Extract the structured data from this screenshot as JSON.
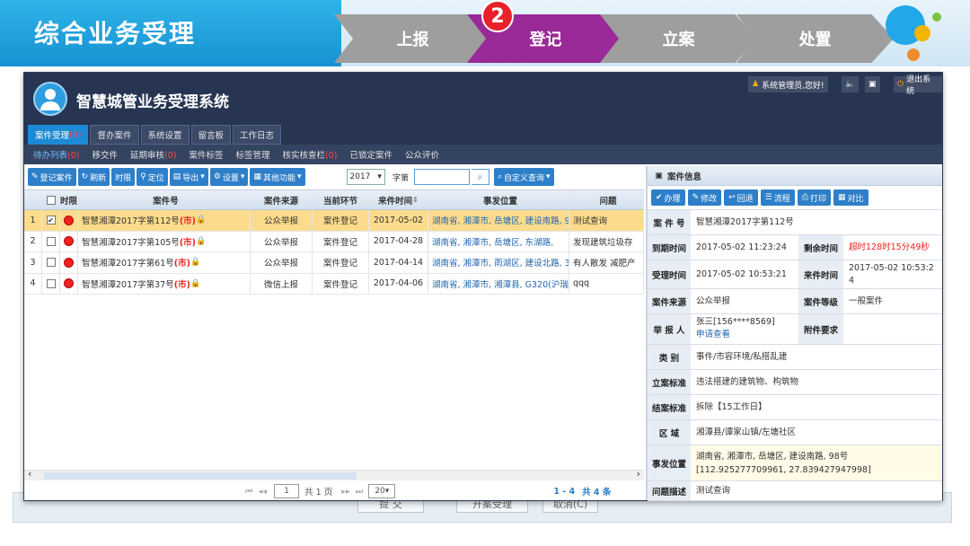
{
  "banner": {
    "title": "综合业务受理",
    "steps": [
      "上报",
      "登记",
      "立案",
      "处置"
    ],
    "active_step_number": "2"
  },
  "app": {
    "title": "智慧城管业务受理系统",
    "header_right": {
      "user": "系统管理员,您好!",
      "logout": "退出系统"
    },
    "menu_tabs": [
      {
        "label": "案件受理",
        "count": "(0)"
      },
      {
        "label": "督办案件"
      },
      {
        "label": "系统设置"
      },
      {
        "label": "留言板"
      },
      {
        "label": "工作日志"
      }
    ],
    "sub_menu": [
      {
        "label": "待办列表",
        "count": "(0)"
      },
      {
        "label": "移交件"
      },
      {
        "label": "延期审核",
        "count": "(0)"
      },
      {
        "label": "案件标签"
      },
      {
        "label": "标签管理"
      },
      {
        "label": "核实核查栏",
        "count": "(0)"
      },
      {
        "label": "已锁定案件"
      },
      {
        "label": "公众评价"
      }
    ],
    "toolbar": {
      "register": "登记案件",
      "refresh": "刷新",
      "time_limit": "时限",
      "locate": "定位",
      "export": "导出",
      "settings": "设置",
      "other": "其他功能",
      "year": "2017",
      "word_label": "字第",
      "custom_query": "自定义查询"
    },
    "table": {
      "headers": [
        "时限",
        "案件号",
        "案件来源",
        "当前环节",
        "来件时间",
        "事发位置",
        "问题"
      ],
      "rows": [
        {
          "no": "1",
          "case": "智慧湘潭2017字第112号",
          "tag": "(市)",
          "source": "公众举报",
          "stage": "案件登记",
          "time": "2017-05-02",
          "location": "湖南省, 湘潭市, 岳塘区, 建设南路, 9",
          "issue": "测试查询",
          "checked": true
        },
        {
          "no": "2",
          "case": "智慧湘潭2017字第105号",
          "tag": "(市)",
          "source": "公众举报",
          "stage": "案件登记",
          "time": "2017-04-28",
          "location": "湖南省, 湘潭市, 岳塘区, 东湖路,",
          "issue": "发现建筑垃圾存",
          "checked": false
        },
        {
          "no": "3",
          "case": "智慧湘潭2017字第61号",
          "tag": "(市)",
          "source": "公众举报",
          "stage": "案件登记",
          "time": "2017-04-14",
          "location": "湖南省, 湘潭市, 雨湖区, 建设北路, 3",
          "issue": "有人散发 减肥产",
          "checked": false
        },
        {
          "no": "4",
          "case": "智慧湘潭2017字第37号",
          "tag": "(市)",
          "source": "微信上报",
          "stage": "案件登记",
          "time": "2017-04-06",
          "location": "湖南省, 湘潭市, 湘潭县, G320(沪瑞)",
          "issue": "qqq",
          "checked": false
        }
      ]
    },
    "pager": {
      "page": "1",
      "total_pages": "共 1 页",
      "page_size": "20",
      "range": "1 - 4",
      "total": "共 4 条"
    },
    "panel": {
      "title": "案件信息",
      "buttons": [
        "办理",
        "修改",
        "回退",
        "流程",
        "打印",
        "对比"
      ],
      "fields": {
        "case_no_label": "案 件 号",
        "case_no": "智慧湘潭2017字第112号",
        "arrive_label": "到期时间",
        "arrive": "2017-05-02 11:23:24",
        "remain_label": "剩余时间",
        "remain": "超时128时15分49秒",
        "accept_label": "受理时间",
        "accept": "2017-05-02 10:53:21",
        "incoming_label": "来件时间",
        "incoming": "2017-05-02 10:53:24",
        "source_label": "案件来源",
        "source": "公众举报",
        "level_label": "案件等级",
        "level": "一般案件",
        "reporter_label": "举 报 人",
        "reporter": "张三[156****8569]",
        "reporter_link": "申请查看",
        "attach_label": "附件要求",
        "attach": "",
        "category_label": "类 别",
        "category": "事件/市容环境/私搭乱建",
        "standard_label": "立案标准",
        "standard": "违法搭建的建筑物、构筑物",
        "close_label": "结案标准",
        "close": "拆除【15工作日】",
        "area_label": "区 域",
        "area": "湘潭县/谭家山镇/左塘社区",
        "place_label": "事发位置",
        "place": "湖南省, 湘潭市, 岳塘区, 建设南路, 98号[112.925277709961, 27.839427947998]",
        "desc_label": "问题描述",
        "desc": "测试查询"
      }
    }
  },
  "background_buttons": [
    "提 交",
    "开案受理",
    "取消(C)"
  ],
  "colors": {
    "active_step": "#9a2a98",
    "step": "#9e9e9e",
    "header": "#273553",
    "button": "#2d7fc9",
    "selected_row": "#fcdc8c"
  }
}
